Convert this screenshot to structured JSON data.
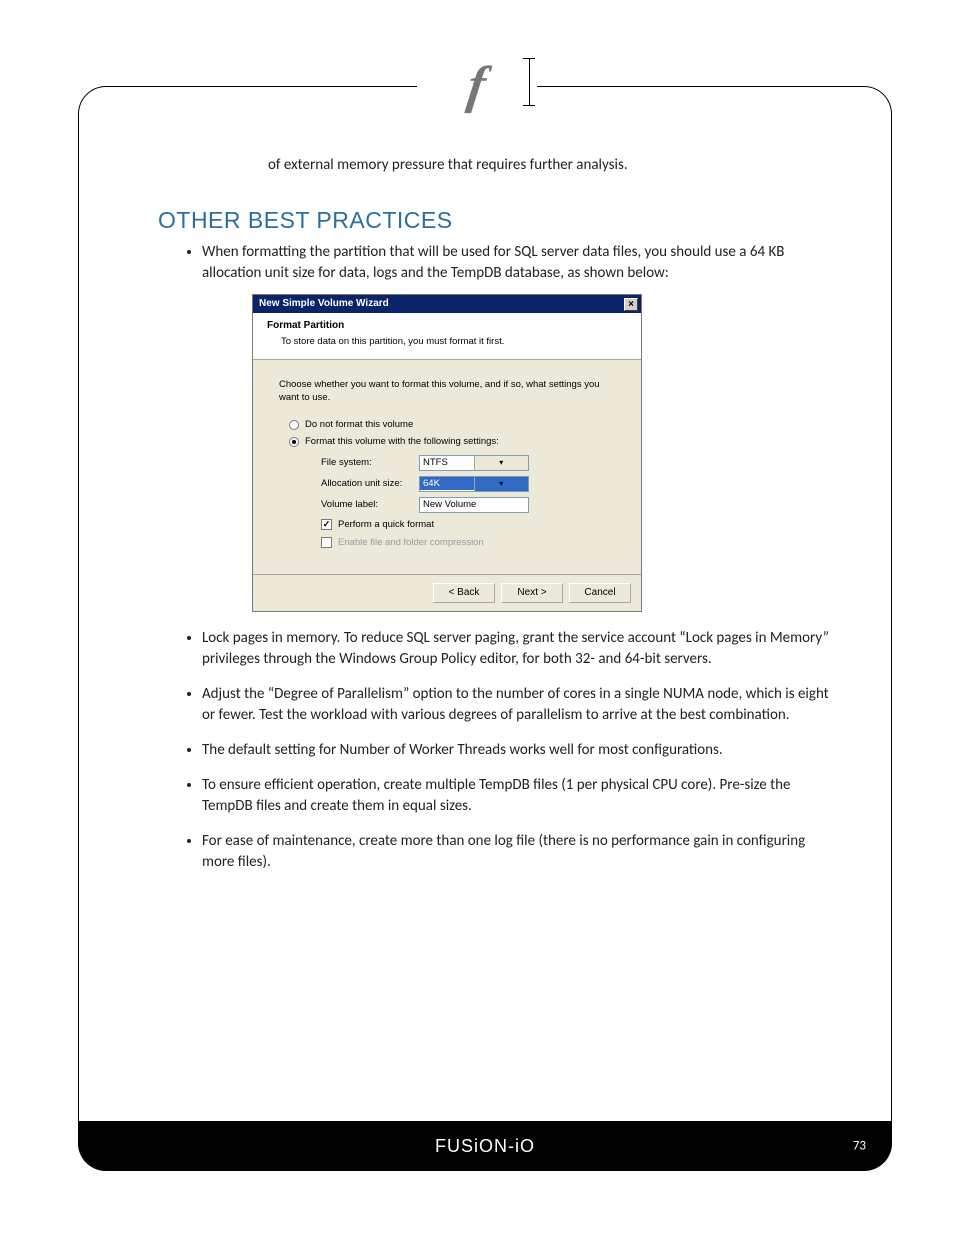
{
  "header": {
    "logo_char": "f"
  },
  "continuation": "of external memory pressure that requires further analysis.",
  "section_title": "OTHER BEST PRACTICES",
  "bullets": [
    "When formatting the partition that will be used for SQL server data files, you should use a 64 KB allocation unit size for data, logs and the TempDB database, as shown below:",
    "Lock pages in memory. To reduce SQL server paging, grant the service account “Lock pages in Memory” privileges through the Windows Group Policy editor, for both 32- and 64-bit servers.",
    "Adjust the “Degree of Parallelism” option to the number of cores in a single NUMA node, which is eight or fewer. Test the workload with various degrees of parallelism to arrive at the best combination.",
    "The default setting for Number of Worker Threads works well for most configurations.",
    "To ensure efficient operation, create multiple TempDB files (1 per physical CPU core). Pre-size the TempDB files and create them in equal sizes.",
    "For ease of maintenance, create more than one log file (there is no performance gain in configuring more files)."
  ],
  "wizard": {
    "title": "New Simple Volume Wizard",
    "header_title": "Format Partition",
    "header_sub": "To store data on this partition, you must format it first.",
    "instruction": "Choose whether you want to format this volume, and if so, what settings you want to use.",
    "opt1": "Do not format this volume",
    "opt2": "Format this volume with the following settings:",
    "fields": {
      "fs_label": "File system:",
      "fs_value": "NTFS",
      "au_label": "Allocation unit size:",
      "au_value": "64K",
      "vl_label": "Volume label:",
      "vl_value": "New Volume"
    },
    "chk_quick": "Perform a quick format",
    "chk_compress": "Enable file and folder compression",
    "buttons": {
      "back": "< Back",
      "next": "Next >",
      "cancel": "Cancel"
    }
  },
  "footer": {
    "brand": "FUSiON‑iO",
    "page": "73"
  }
}
